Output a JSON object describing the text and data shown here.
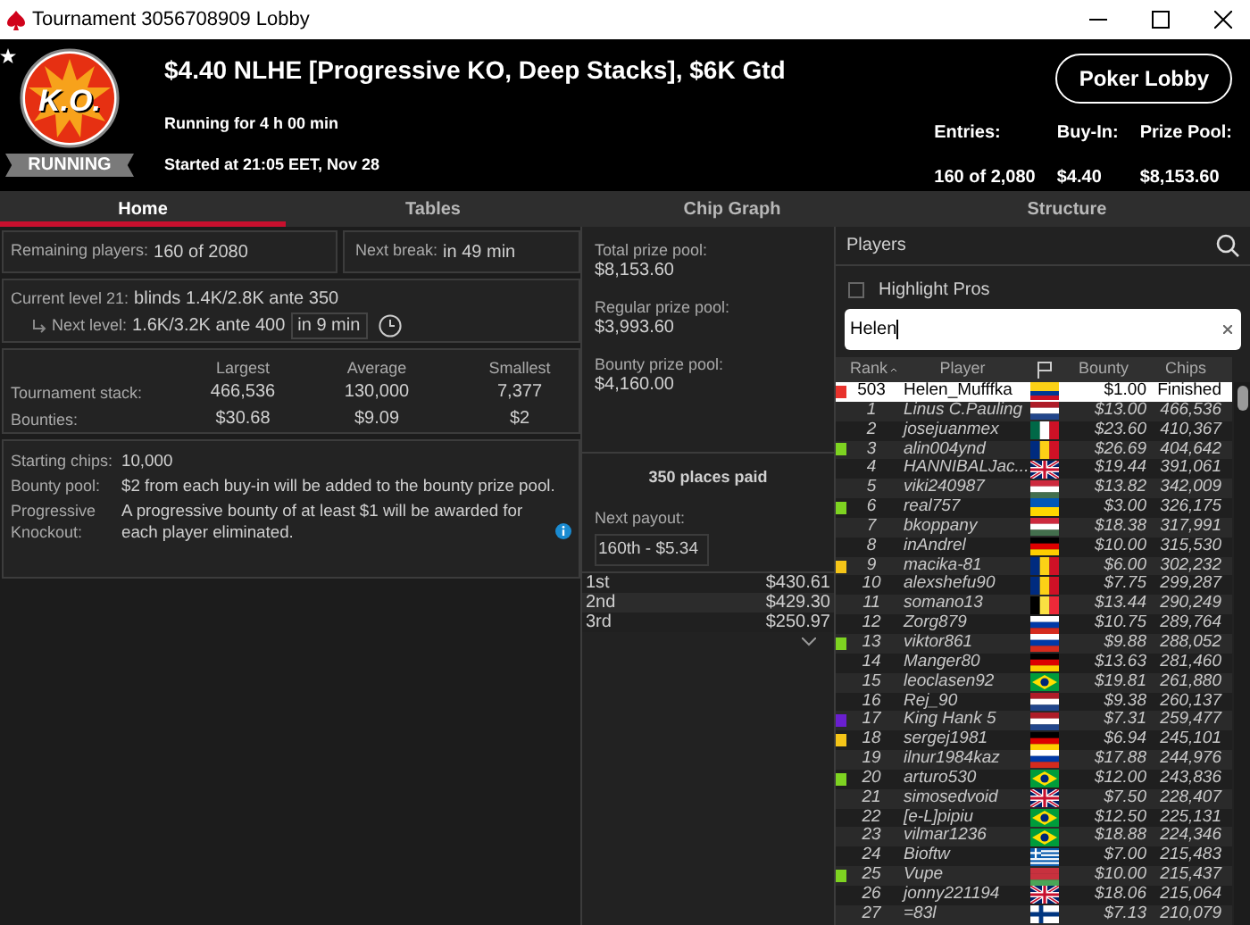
{
  "window": {
    "title": "Tournament 3056708909 Lobby"
  },
  "header": {
    "logo_text": "K.O.",
    "status": "RUNNING",
    "title": "$4.40 NLHE [Progressive KO, Deep Stacks], $6K Gtd",
    "running_for": "Running for 4 h 00 min",
    "started": "Started at 21:05 EET, Nov 28",
    "lobby_button": "Poker Lobby",
    "stats": [
      {
        "label": "Entries:",
        "value": "160 of 2,080"
      },
      {
        "label": "Buy-In:",
        "value": "$4.40"
      },
      {
        "label": "Prize Pool:",
        "value": "$8,153.60"
      }
    ]
  },
  "tabs": [
    {
      "label": "Home",
      "selected": true
    },
    {
      "label": "Tables",
      "selected": false
    },
    {
      "label": "Chip Graph",
      "selected": false
    },
    {
      "label": "Structure",
      "selected": false
    }
  ],
  "overview": {
    "remaining_label": "Remaining players:",
    "remaining_value": "160 of 2080",
    "break_label": "Next break:",
    "break_value": "in 49 min",
    "level_label": "Current level 21:",
    "level_value": "blinds 1.4K/2.8K ante 350",
    "next_label": "Next level:",
    "next_value": "1.6K/3.2K ante 400",
    "next_time": "in 9 min",
    "stack_columns": [
      "Largest",
      "Average",
      "Smallest"
    ],
    "stack_rows": [
      {
        "label": "Tournament stack:",
        "values": [
          "466,536",
          "130,000",
          "7,377"
        ]
      },
      {
        "label": "Bounties:",
        "values": [
          "$30.68",
          "$9.09",
          "$2"
        ]
      }
    ],
    "details": [
      {
        "label": "Starting chips:",
        "value": "10,000",
        "info": false
      },
      {
        "label": "Bounty pool:",
        "value": "$2 from each buy-in will be added to the bounty prize pool.",
        "info": false
      },
      {
        "label": "Progressive Knockout:",
        "value": "A progressive bounty of at least $1 will be awarded for each player eliminated.",
        "info": true
      }
    ]
  },
  "prizes": {
    "pools": [
      {
        "label": "Total prize pool:",
        "value": "$8,153.60"
      },
      {
        "label": "Regular prize pool:",
        "value": "$3,993.60"
      },
      {
        "label": "Bounty prize pool:",
        "value": "$4,160.00"
      }
    ],
    "places_paid": "350 places paid",
    "next_payout_label": "Next payout:",
    "next_payout": "160th - $5.34",
    "payouts": [
      {
        "place": "1st",
        "amount": "$430.61"
      },
      {
        "place": "2nd",
        "amount": "$429.30"
      },
      {
        "place": "3rd",
        "amount": "$250.97"
      }
    ]
  },
  "players": {
    "title": "Players",
    "highlight_pros": {
      "label": "Highlight Pros",
      "checked": false
    },
    "search_value": "Helen",
    "columns": [
      "Rank",
      "Player",
      "Bounty",
      "Chips"
    ],
    "rows": [
      {
        "rank": "503",
        "player": "Helen_Mufffka",
        "flag": {
          "kind": "co"
        },
        "bounty": "$1.00",
        "chips": "Finished",
        "selected": true,
        "color": "#e8322c"
      },
      {
        "rank": "1",
        "player": "Linus C.Pauling",
        "flag": {
          "kind": "nl"
        },
        "bounty": "$13.00",
        "chips": "466,536",
        "selected": false
      },
      {
        "rank": "2",
        "player": "josejuanmex",
        "flag": {
          "kind": "mx"
        },
        "bounty": "$23.60",
        "chips": "410,367",
        "selected": false
      },
      {
        "rank": "3",
        "player": "alin004ynd",
        "flag": {
          "kind": "ro"
        },
        "bounty": "$26.69",
        "chips": "404,642",
        "selected": false,
        "color": "#7ed321"
      },
      {
        "rank": "4",
        "player": "HANNIBALJac...",
        "flag": {
          "kind": "gb"
        },
        "bounty": "$19.44",
        "chips": "391,061",
        "selected": false
      },
      {
        "rank": "5",
        "player": "viki240987",
        "flag": {
          "kind": "hu"
        },
        "bounty": "$13.82",
        "chips": "342,009",
        "selected": false
      },
      {
        "rank": "6",
        "player": "real757",
        "flag": {
          "kind": "ua"
        },
        "bounty": "$3.00",
        "chips": "326,175",
        "selected": false,
        "color": "#7ed321"
      },
      {
        "rank": "7",
        "player": "bkoppany",
        "flag": {
          "kind": "hu"
        },
        "bounty": "$18.38",
        "chips": "317,991",
        "selected": false
      },
      {
        "rank": "8",
        "player": "inAndrel",
        "flag": {
          "kind": "de"
        },
        "bounty": "$10.00",
        "chips": "315,530",
        "selected": false
      },
      {
        "rank": "9",
        "player": "macika-81",
        "flag": {
          "kind": "ro"
        },
        "bounty": "$6.00",
        "chips": "302,232",
        "selected": false,
        "color": "#f5c518"
      },
      {
        "rank": "10",
        "player": "alexshefu90",
        "flag": {
          "kind": "ro"
        },
        "bounty": "$7.75",
        "chips": "299,287",
        "selected": false
      },
      {
        "rank": "11",
        "player": "somano13",
        "flag": {
          "kind": "be"
        },
        "bounty": "$13.44",
        "chips": "290,249",
        "selected": false
      },
      {
        "rank": "12",
        "player": "Zorg879",
        "flag": {
          "kind": "ru"
        },
        "bounty": "$10.75",
        "chips": "289,764",
        "selected": false
      },
      {
        "rank": "13",
        "player": "viktor861",
        "flag": {
          "kind": "ru"
        },
        "bounty": "$9.88",
        "chips": "288,052",
        "selected": false,
        "color": "#7ed321"
      },
      {
        "rank": "14",
        "player": "Manger80",
        "flag": {
          "kind": "de"
        },
        "bounty": "$13.63",
        "chips": "281,460",
        "selected": false
      },
      {
        "rank": "15",
        "player": "leoclasen92",
        "flag": {
          "kind": "br"
        },
        "bounty": "$19.81",
        "chips": "261,880",
        "selected": false
      },
      {
        "rank": "16",
        "player": "Rej_90",
        "flag": {
          "kind": "nl"
        },
        "bounty": "$9.38",
        "chips": "260,137",
        "selected": false
      },
      {
        "rank": "17",
        "player": "King Hank 5",
        "flag": {
          "kind": "nl"
        },
        "bounty": "$7.31",
        "chips": "259,477",
        "selected": false,
        "color": "#6a1fd0"
      },
      {
        "rank": "18",
        "player": "sergej1981",
        "flag": {
          "kind": "de"
        },
        "bounty": "$6.94",
        "chips": "245,101",
        "selected": false,
        "color": "#f5c518"
      },
      {
        "rank": "19",
        "player": "ilnur1984kaz",
        "flag": {
          "kind": "ru"
        },
        "bounty": "$17.88",
        "chips": "244,976",
        "selected": false
      },
      {
        "rank": "20",
        "player": "arturo530",
        "flag": {
          "kind": "br"
        },
        "bounty": "$12.00",
        "chips": "243,836",
        "selected": false,
        "color": "#7ed321"
      },
      {
        "rank": "21",
        "player": "simosedvoid",
        "flag": {
          "kind": "gb"
        },
        "bounty": "$7.50",
        "chips": "228,407",
        "selected": false
      },
      {
        "rank": "22",
        "player": "[e-L]pipiu",
        "flag": {
          "kind": "br"
        },
        "bounty": "$12.50",
        "chips": "225,131",
        "selected": false
      },
      {
        "rank": "23",
        "player": "vilmar1236",
        "flag": {
          "kind": "br"
        },
        "bounty": "$18.88",
        "chips": "224,346",
        "selected": false
      },
      {
        "rank": "24",
        "player": "Bioftw",
        "flag": {
          "kind": "gr"
        },
        "bounty": "$7.00",
        "chips": "215,483",
        "selected": false
      },
      {
        "rank": "25",
        "player": "Vupe",
        "flag": {
          "kind": "by"
        },
        "bounty": "$10.00",
        "chips": "215,437",
        "selected": false,
        "color": "#7ed321"
      },
      {
        "rank": "26",
        "player": "jonny221194",
        "flag": {
          "kind": "gb"
        },
        "bounty": "$18.06",
        "chips": "215,064",
        "selected": false
      },
      {
        "rank": "27",
        "player": "=83l",
        "flag": {
          "kind": "fi"
        },
        "bounty": "$7.13",
        "chips": "210,079",
        "selected": false
      }
    ]
  }
}
